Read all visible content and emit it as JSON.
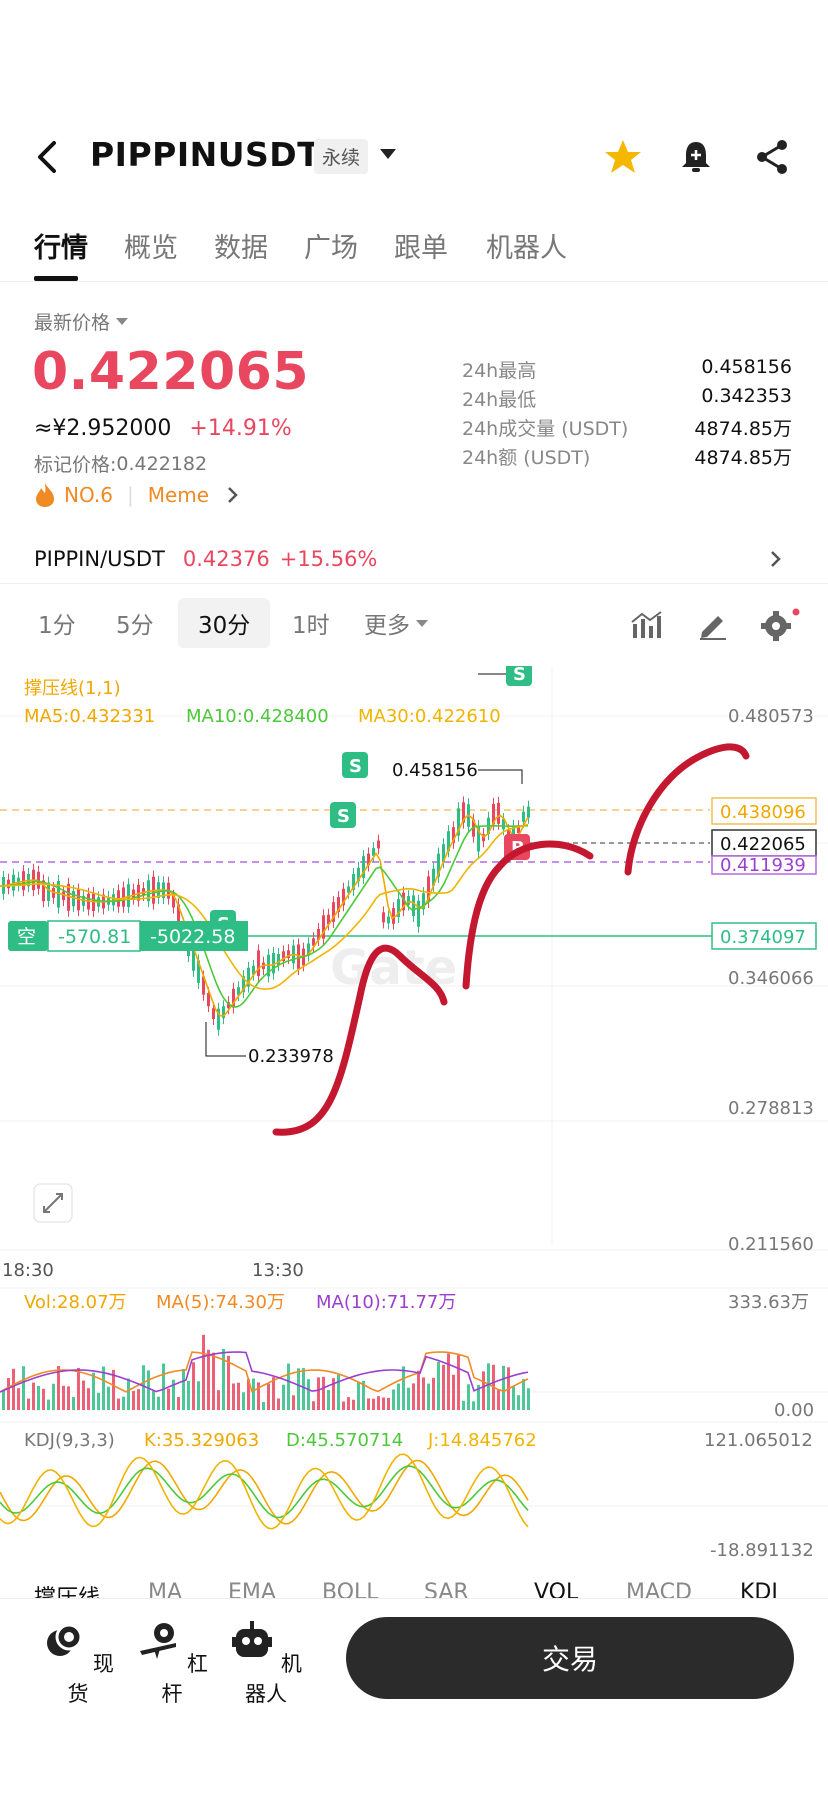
{
  "header": {
    "symbol": "PIPPINUSDT",
    "contract_type": "永续"
  },
  "tabs": [
    "行情",
    "概览",
    "数据",
    "广场",
    "跟单",
    "机器人"
  ],
  "price": {
    "label": "最新价格",
    "last": "0.422065",
    "cny": "≈¥2.952000",
    "change": "+14.91%",
    "mark_label": "标记价格:",
    "mark": "0.422182",
    "rank": "NO.6",
    "tag": "Meme"
  },
  "stats": [
    {
      "k": "24h最高",
      "v": "0.458156"
    },
    {
      "k": "24h最低",
      "v": "0.342353"
    },
    {
      "k": "24h成交量 (USDT)",
      "v": "4874.85万"
    },
    {
      "k": "24h额 (USDT)",
      "v": "4874.85万"
    }
  ],
  "spot": {
    "pair": "PIPPIN/USDT",
    "price": "0.42376",
    "change": "+15.56%"
  },
  "timeframes": [
    "1分",
    "5分",
    "30分",
    "1时",
    "更多"
  ],
  "active_timeframe": 2,
  "chart": {
    "indicator": "撑压线(1,1)",
    "ma5": "MA5:0.432331",
    "ma10": "MA10:0.428400",
    "ma30": "MA30:0.422610",
    "axis": [
      "0.480573",
      "0.438096",
      "0.422065",
      "0.411939",
      "0.374097",
      "0.346066",
      "0.278813",
      "0.211560"
    ],
    "high_label": "0.458156",
    "low_label": "0.233978",
    "position": {
      "side": "空",
      "pnl": "-570.81",
      "pnl2": "-5022.58"
    },
    "times": [
      "18:30",
      "13:30"
    ],
    "watermark": "Gate",
    "marker_s": "S",
    "marker_b": "B"
  },
  "volume": {
    "vol": "Vol:28.07万",
    "ma5": "MA(5):74.30万",
    "ma10": "MA(10):71.77万",
    "max": "333.63万",
    "min": "0.00"
  },
  "kdj": {
    "label": "KDJ(9,3,3)",
    "k": "K:35.329063",
    "d": "D:45.570714",
    "j": "J:14.845762",
    "max": "121.065012",
    "min": "-18.891132"
  },
  "indicator_tabs": [
    "撑压线",
    "MA",
    "EMA",
    "BOLL",
    "SAR",
    "VOL",
    "MACD",
    "KDJ"
  ],
  "bottom_nav": [
    "现货",
    "杠杆",
    "机器人"
  ],
  "trade_button": "交易",
  "colors": {
    "up": "#2ebd85",
    "down": "#e8475f",
    "ma5": "#f0a800",
    "ma10": "#4cc93a",
    "ma30": "#f0b400",
    "purple": "#9b3fd0"
  }
}
